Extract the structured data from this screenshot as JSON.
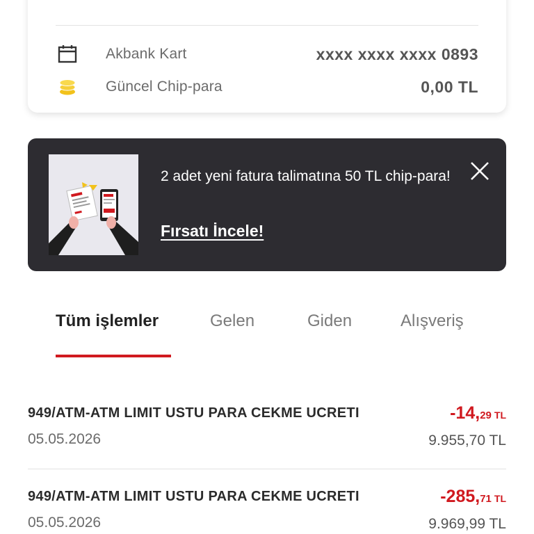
{
  "card": {
    "rows": [
      {
        "icon": "calendar-icon",
        "label": "Akbank Kart",
        "value": "xxxx xxxx xxxx 0893"
      },
      {
        "icon": "coin-stack-icon",
        "label": "Güncel Chip-para",
        "value": "0,00 TL"
      }
    ]
  },
  "banner": {
    "text": "2 adet yeni fatura talimatına 50 TL chip-para!",
    "link": "Fırsatı İncele!",
    "close_icon": "close-icon"
  },
  "tabs": [
    {
      "label": "Tüm işlemler",
      "active": true
    },
    {
      "label": "Gelen",
      "active": false
    },
    {
      "label": "Giden",
      "active": false
    },
    {
      "label": "Alışveriş",
      "active": false
    }
  ],
  "transactions": [
    {
      "description": "949/ATM-ATM LIMIT USTU PARA CEKME UCRETI",
      "date": "05.05.2026",
      "amount_main": "-14,",
      "amount_decimal": "29",
      "amount_currency": "TL",
      "balance": "9.955,70 TL"
    },
    {
      "description": "949/ATM-ATM LIMIT USTU PARA CEKME UCRETI",
      "date": "05.05.2026",
      "amount_main": "-285,",
      "amount_decimal": "71",
      "amount_currency": "TL",
      "balance": "9.969,99 TL"
    }
  ],
  "colors": {
    "accent_red": "#d0191f",
    "banner_bg": "#2d2c31",
    "coin_yellow": "#f2c21b"
  }
}
